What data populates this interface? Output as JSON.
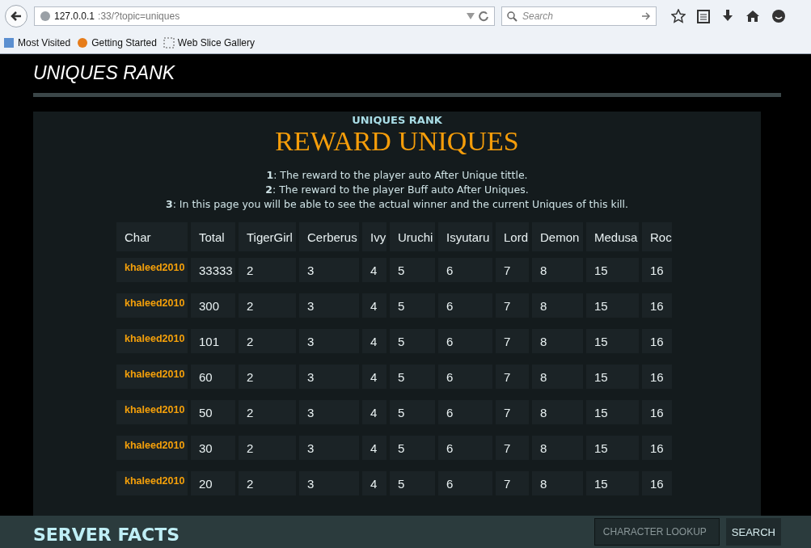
{
  "browser": {
    "url_host": "127.0.0.1",
    "url_rest": ":33/?topic=uniques",
    "search_placeholder": "Search",
    "bookmarks": [
      "Most Visited",
      "Getting Started",
      "Web Slice Gallery"
    ]
  },
  "page_title": "UNIQUES RANK",
  "panel": {
    "subtitle": "UNIQUES RANK",
    "heading": "REWARD UNIQUES",
    "notes": [
      "**1**: The reward to the player auto After Unique tittle.",
      "**2**: The reward to the player Buff auto After Uniques.",
      "**3**: In this page you will be able to see the actual winner and the current Uniques of this kill."
    ]
  },
  "table": {
    "columns": [
      "Char",
      "Total",
      "TigerGirl",
      "Cerberus",
      "Ivy",
      "Uruchi",
      "Isyutaru",
      "Lord",
      "Demon",
      "Medusa",
      "Roc"
    ],
    "rows": [
      [
        "khaleed2010",
        "33333",
        "2",
        "3",
        "4",
        "5",
        "6",
        "7",
        "8",
        "15",
        "16"
      ],
      [
        "khaleed2010",
        "300",
        "2",
        "3",
        "4",
        "5",
        "6",
        "7",
        "8",
        "15",
        "16"
      ],
      [
        "khaleed2010",
        "101",
        "2",
        "3",
        "4",
        "5",
        "6",
        "7",
        "8",
        "15",
        "16"
      ],
      [
        "khaleed2010",
        "60",
        "2",
        "3",
        "4",
        "5",
        "6",
        "7",
        "8",
        "15",
        "16"
      ],
      [
        "khaleed2010",
        "50",
        "2",
        "3",
        "4",
        "5",
        "6",
        "7",
        "8",
        "15",
        "16"
      ],
      [
        "khaleed2010",
        "30",
        "2",
        "3",
        "4",
        "5",
        "6",
        "7",
        "8",
        "15",
        "16"
      ],
      [
        "khaleed2010",
        "20",
        "2",
        "3",
        "4",
        "5",
        "6",
        "7",
        "8",
        "15",
        "16"
      ]
    ]
  },
  "footer": {
    "title": "SERVER FACTS",
    "lookup_placeholder": "CHARACTER LOOKUP",
    "search_button": "SEARCH"
  }
}
